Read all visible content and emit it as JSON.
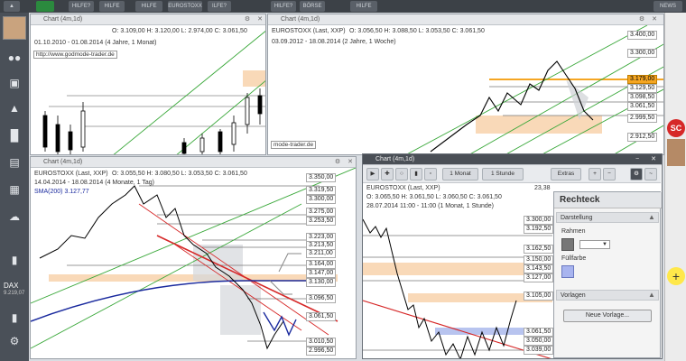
{
  "topbar": {
    "buttons": [
      "",
      "",
      "HILFE?",
      "",
      "HILFE",
      "EUROSTOXX",
      "ILFE?",
      "",
      "",
      "BÖRSE",
      "AKTIEN",
      "",
      "",
      "NEWS"
    ]
  },
  "chart1": {
    "title": "Chart (4m,1d)",
    "date_range": "01.10.2010 - 01.08.2014 (4 Jahre, 1 Monat)",
    "url": "http://www.godmode-trader.de",
    "ohlc": "O: 3.109,00 H: 3.120,00 L: 2.974,00 C: 3.061,50",
    "symbol": "EUROSTOXX"
  },
  "chart2": {
    "title": "Chart (4m,1d)",
    "symbol": "EUROSTOXX (Last, XXP)",
    "ohlc": "O: 3.056,50 H: 3.088,50 L: 3.053,50 C: 3.061,50",
    "date_range": "03.09.2012 - 18.08.2014 (2 Jahre, 1 Woche)",
    "watermark": "mode-trader.de",
    "price_labels": [
      "3.400,00",
      "3.300,00",
      "3.179,00",
      "3.129,50",
      "3.098,50",
      "3.061,50",
      "2.999,50",
      "2.912,50"
    ]
  },
  "chart3": {
    "title": "Chart (4m,1d)",
    "symbol": "EUROSTOXX (Last, XXP)",
    "ohlc": "O: 3.055,50 H: 3.080,50 L: 3.053,50 C: 3.061,50",
    "date_range": "14.04.2014 - 18.08.2014 (4 Monate, 1 Tag)",
    "sma": "SMA(200) 3.127,77",
    "price_labels": [
      "3.350,00",
      "3.319,50",
      "3.300,00",
      "3.275,00",
      "3.253,50",
      "3.223,00",
      "3.213,50",
      "3.211,00",
      "3.164,00",
      "3.147,00",
      "3.130,00",
      "3.096,50",
      "3.061,50",
      "3.010,50",
      "2.996,50"
    ]
  },
  "chart4": {
    "title": "Chart (4m,1d)",
    "symbol": "EUROSTOXX (Last, XXP)",
    "ohlc": "O: 3.065,50 H: 3.061,50 L: 3.060,50 C: 3.061,50",
    "date_range": "28.07.2014 11:00 - 11:00 (1 Monat, 1 Stunde)",
    "toolbar": {
      "period": "1 Monat",
      "interval": "1 Stunde",
      "extras": "Extras"
    },
    "price_labels": [
      "3.300,00",
      "3.192,50",
      "3.162,50",
      "3.150,00",
      "3.143,50",
      "3.127,00",
      "3.105,00",
      "3.061,50",
      "3.050,00",
      "3.039,00",
      "3.031,00"
    ],
    "top_value": "23,38"
  },
  "panel": {
    "title": "Rechteck",
    "sec1": "Darstellung",
    "rahmen": "Rahmen",
    "fuellfarbe": "Füllfarbe",
    "sec2": "Vorlagen",
    "btn": "Neue Vorlage..."
  },
  "sidebar": {
    "dax_label": "DAX",
    "dax_value": "9.219,07"
  },
  "colors": {
    "orange": "#f5a623",
    "zone": "#f9d9b8",
    "sma": "#1a2a9e",
    "trend": "#3aa83a",
    "red": "#d62828"
  }
}
